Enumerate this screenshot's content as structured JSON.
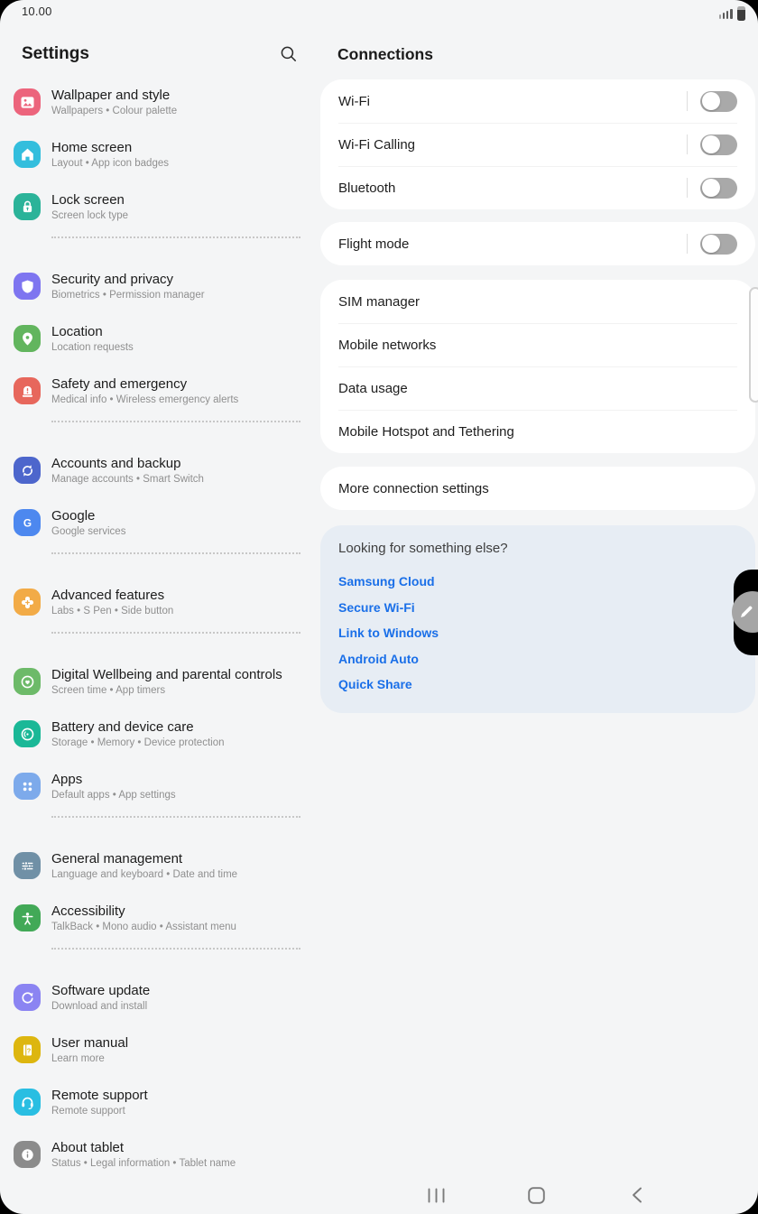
{
  "status_bar": {
    "time": "10.00",
    "signal_icon": "signal-strength-icon",
    "battery_icon": "battery-icon"
  },
  "sidebar": {
    "title": "Settings",
    "search_icon": "search-icon",
    "items": [
      {
        "title": "Wallpaper and style",
        "subtitle": "Wallpapers  •  Colour palette",
        "icon": "wallpaper-icon",
        "color": "#ec647c"
      },
      {
        "title": "Home screen",
        "subtitle": "Layout  •  App icon badges",
        "icon": "home-screen-icon",
        "color": "#33bedd"
      },
      {
        "title": "Lock screen",
        "subtitle": "Screen lock type",
        "icon": "lock-icon",
        "color": "#2bb399"
      },
      {
        "title": "Security and privacy",
        "subtitle": "Biometrics  •  Permission manager",
        "icon": "shield-icon",
        "color": "#7e75f0"
      },
      {
        "title": "Location",
        "subtitle": "Location requests",
        "icon": "location-pin-icon",
        "color": "#62b55e"
      },
      {
        "title": "Safety and emergency",
        "subtitle": "Medical info  •  Wireless emergency alerts",
        "icon": "emergency-siren-icon",
        "color": "#e7675c"
      },
      {
        "title": "Accounts and backup",
        "subtitle": "Manage accounts  •  Smart Switch",
        "icon": "sync-icon",
        "color": "#4d66cc"
      },
      {
        "title": "Google",
        "subtitle": "Google services",
        "icon": "google-g-icon",
        "color": "#4d88ef"
      },
      {
        "title": "Advanced features",
        "subtitle": "Labs  •  S Pen  •  Side button",
        "icon": "advanced-features-icon",
        "color": "#f2ab47"
      },
      {
        "title": "Digital Wellbeing and parental controls",
        "subtitle": "Screen time  •  App timers",
        "icon": "wellbeing-heart-icon",
        "color": "#6dba69"
      },
      {
        "title": "Battery and device care",
        "subtitle": "Storage  •  Memory  •  Device protection",
        "icon": "device-care-icon",
        "color": "#1ab897"
      },
      {
        "title": "Apps",
        "subtitle": "Default apps  •  App settings",
        "icon": "apps-grid-icon",
        "color": "#7daaeb"
      },
      {
        "title": "General management",
        "subtitle": "Language and keyboard  •  Date and time",
        "icon": "sliders-icon",
        "color": "#7090a6"
      },
      {
        "title": "Accessibility",
        "subtitle": "TalkBack  •  Mono audio  •  Assistant menu",
        "icon": "accessibility-person-icon",
        "color": "#42a957"
      },
      {
        "title": "Software update",
        "subtitle": "Download and install",
        "icon": "software-update-icon",
        "color": "#8b84f2"
      },
      {
        "title": "User manual",
        "subtitle": "Learn more",
        "icon": "user-manual-icon",
        "color": "#ddb60f"
      },
      {
        "title": "Remote support",
        "subtitle": "Remote support",
        "icon": "headset-icon",
        "color": "#29bee2"
      },
      {
        "title": "About tablet",
        "subtitle": "Status  •  Legal information  •  Tablet name",
        "icon": "info-icon",
        "color": "#8b8b8b"
      }
    ]
  },
  "main": {
    "title": "Connections",
    "toggle_rows": [
      {
        "label": "Wi-Fi",
        "state": "off"
      },
      {
        "label": "Wi-Fi Calling",
        "state": "off"
      },
      {
        "label": "Bluetooth",
        "state": "off"
      }
    ],
    "flight_mode": {
      "label": "Flight mode",
      "state": "off"
    },
    "network_rows": [
      "SIM manager",
      "Mobile networks",
      "Data usage",
      "Mobile Hotspot and Tethering"
    ],
    "more_row": "More connection settings",
    "suggestions": {
      "header": "Looking for something else?",
      "links": [
        "Samsung Cloud",
        "Secure Wi-Fi",
        "Link to Windows",
        "Android Auto",
        "Quick Share"
      ],
      "link_color": "#1a6fe8",
      "bg_color": "#e7edf4"
    }
  },
  "nav_bar": {
    "recents_icon": "recents-icon",
    "home_icon": "home-nav-icon",
    "back_icon": "back-chevron-icon"
  },
  "edge": {
    "scrollbar": "edge-scrollbar-handle",
    "pen_button": "pen-edit-icon"
  }
}
